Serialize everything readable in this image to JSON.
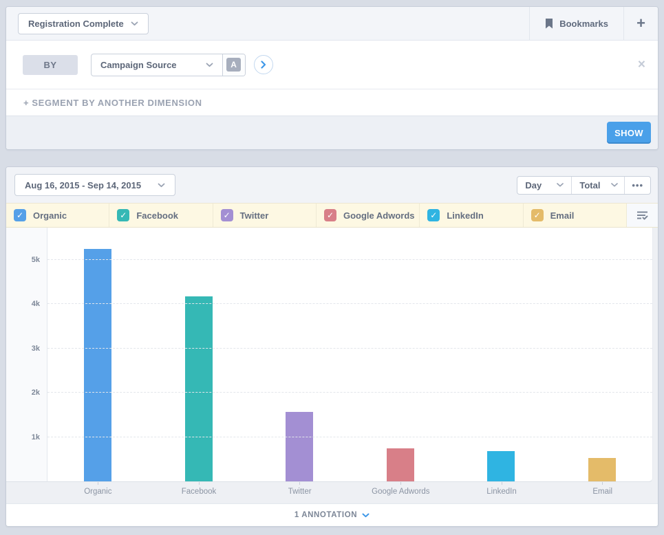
{
  "icons": {
    "checkmark": "✓",
    "close": "×",
    "plus": "+"
  },
  "header": {
    "event_selector": {
      "label": "Registration Complete"
    },
    "bookmarks": {
      "label": "Bookmarks"
    },
    "add_button": {
      "label": "+"
    }
  },
  "segmentation": {
    "by_label": "BY",
    "dimension_selector": {
      "label": "Campaign Source",
      "badge": "A"
    },
    "add_segment_label": "+ SEGMENT BY ANOTHER DIMENSION",
    "show_button": "SHOW"
  },
  "chart_toolbar": {
    "date_range": "Aug 16, 2015 - Sep 14, 2015",
    "interval": "Day",
    "metric": "Total",
    "more_label": "•••"
  },
  "annotations": {
    "label": "1 ANNOTATION"
  },
  "colors": {
    "accent_blue": "#3d97e8",
    "show_button_bg": "#4aa0e9",
    "legend_bg": "#fdf8e3"
  },
  "chart_data": {
    "type": "bar",
    "title": "",
    "xlabel": "",
    "ylabel": "",
    "categories": [
      "Organic",
      "Facebook",
      "Twitter",
      "Google Adwords",
      "LinkedIn",
      "Email"
    ],
    "values": [
      5240,
      4170,
      1570,
      740,
      690,
      530
    ],
    "colors": [
      "#55a0e8",
      "#35b8b5",
      "#a38fd3",
      "#d87f88",
      "#2fb4e2",
      "#e4bb69"
    ],
    "ylim": [
      0,
      5725
    ],
    "yticks": [
      {
        "label": "1k",
        "value": 1000
      },
      {
        "label": "2k",
        "value": 2000
      },
      {
        "label": "3k",
        "value": 3000
      },
      {
        "label": "4k",
        "value": 4000
      },
      {
        "label": "5k",
        "value": 5000
      }
    ],
    "grid": "horizontal-dashed",
    "legend_position": "top",
    "legend": [
      {
        "label": "Organic",
        "color": "#55a0e8",
        "checked": true
      },
      {
        "label": "Facebook",
        "color": "#35b8b5",
        "checked": true
      },
      {
        "label": "Twitter",
        "color": "#a38fd3",
        "checked": true
      },
      {
        "label": "Google Adwords",
        "color": "#d87f88",
        "checked": true
      },
      {
        "label": "LinkedIn",
        "color": "#2fb4e2",
        "checked": true
      },
      {
        "label": "Email",
        "color": "#e4bb69",
        "checked": true
      }
    ]
  }
}
